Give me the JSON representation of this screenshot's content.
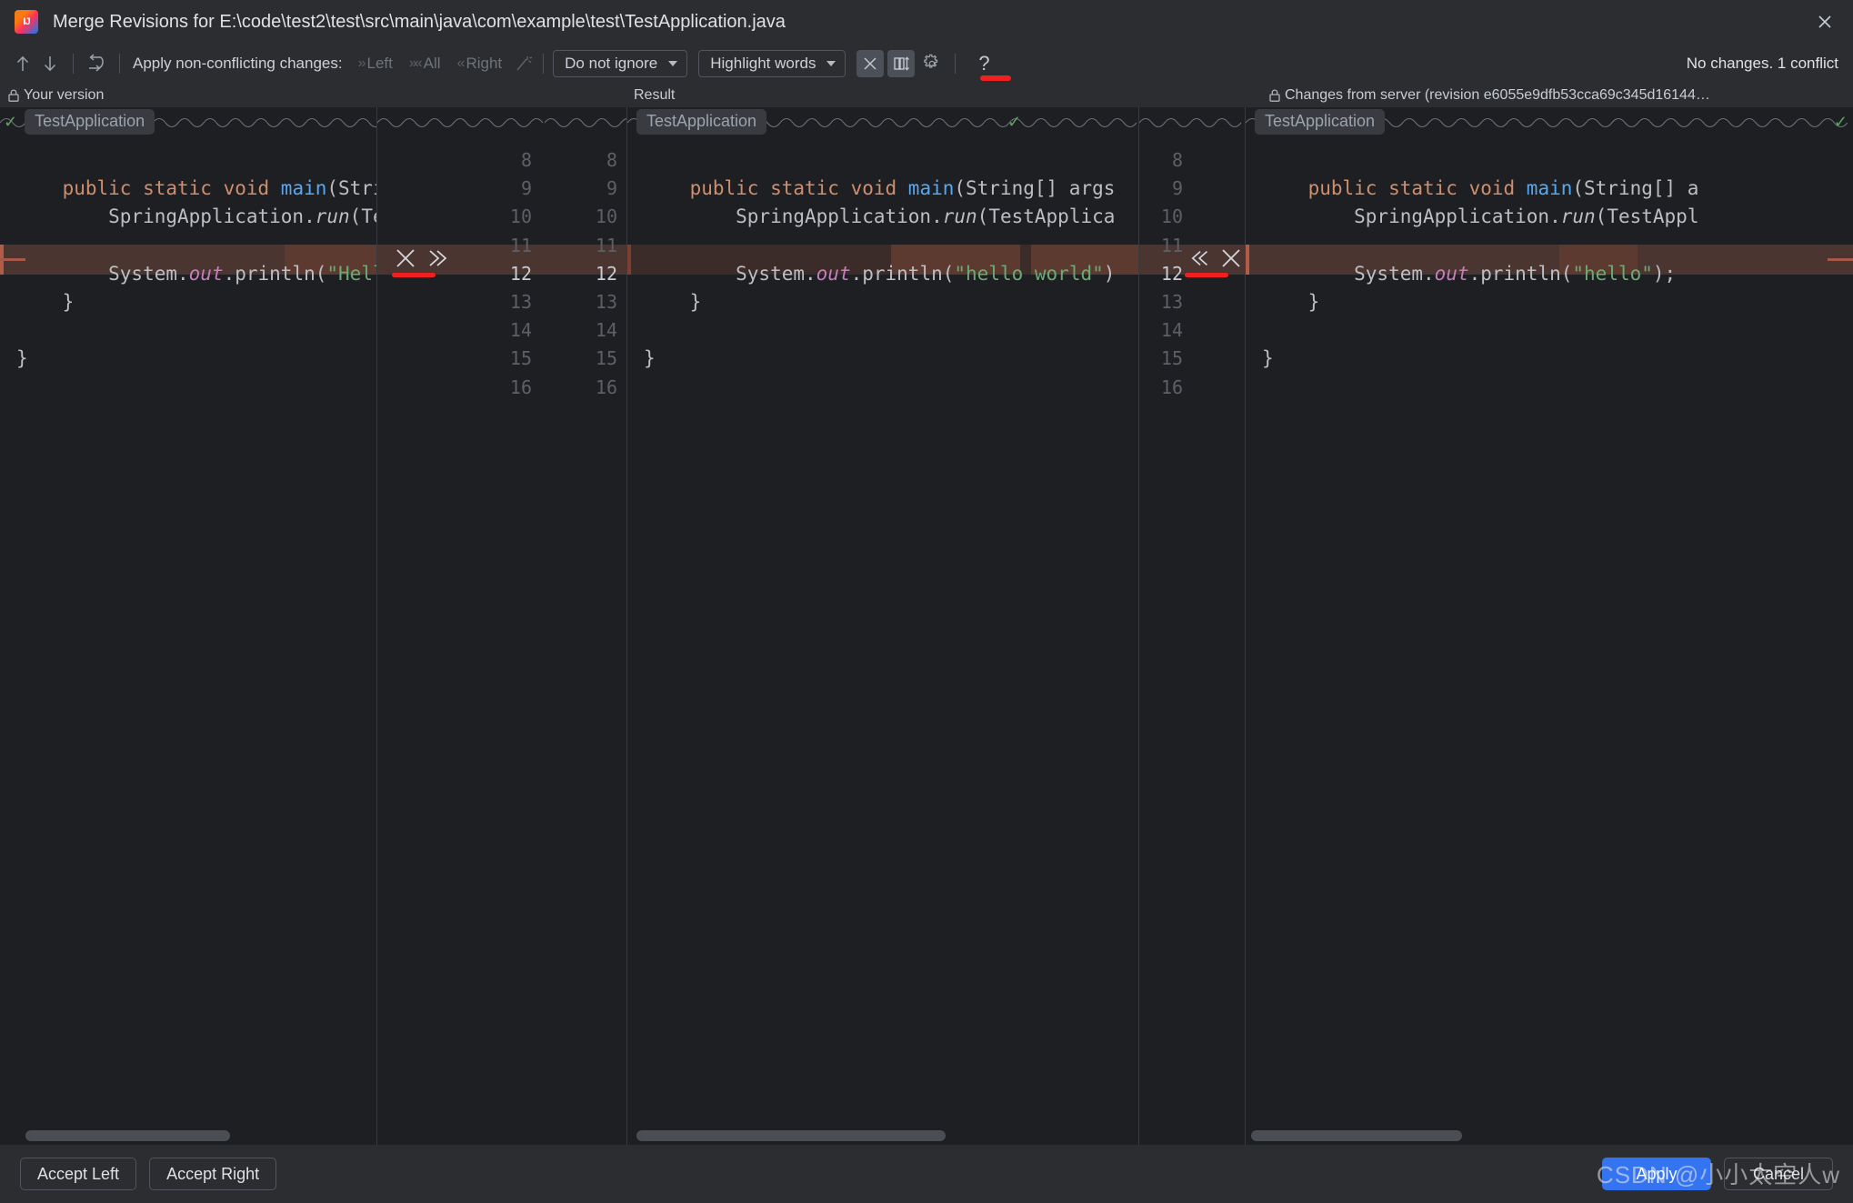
{
  "window": {
    "title": "Merge Revisions for E:\\code\\test2\\test\\src\\main\\java\\com\\example\\test\\TestApplication.java",
    "app_icon": "intellij-idea-icon",
    "close_icon": "close-icon"
  },
  "toolbar": {
    "prev_icon": "arrow-up-icon",
    "next_icon": "arrow-down-icon",
    "revert_icon": "revert-changes-icon",
    "apply_label": "Apply non-conflicting changes:",
    "apply_left": "Left",
    "apply_all": "All",
    "apply_right": "Right",
    "magic_icon": "magic-resolve-icon",
    "ignore_select": "Do not ignore",
    "highlight_select": "Highlight words",
    "collapse_icon": "collapse-unchanged-icon",
    "sync_scroll_icon": "synchronize-scrolling-icon",
    "settings_icon": "gear-icon",
    "help_icon": "help-icon",
    "status": "No changes. 1 conflict"
  },
  "panes": {
    "left_title": "Your version",
    "left_lock_icon": "lock-icon",
    "center_title": "Result",
    "right_title": "Changes from server (revision e6055e9dfb53cca69c345d16144…",
    "right_lock_icon": "lock-icon",
    "breadcrumb": "TestApplication",
    "breadcrumb_check_icon": "check-icon"
  },
  "code": {
    "left": {
      "lines": [
        {
          "tokens": [
            {
              "t": "",
              "c": "pln"
            }
          ]
        },
        {
          "tokens": [
            {
              "t": "    ",
              "c": "pln"
            },
            {
              "t": "public static void ",
              "c": "kw"
            },
            {
              "t": "main",
              "c": "meth"
            },
            {
              "t": "(String[] ",
              "c": "pln"
            }
          ]
        },
        {
          "tokens": [
            {
              "t": "        SpringApplication.",
              "c": "pln"
            },
            {
              "t": "run",
              "c": "ital"
            },
            {
              "t": "(TestApp",
              "c": "pln"
            }
          ]
        },
        {
          "tokens": [
            {
              "t": "",
              "c": "pln"
            }
          ]
        },
        {
          "tokens": [
            {
              "t": "        System.",
              "c": "pln"
            },
            {
              "t": "out",
              "c": "fld"
            },
            {
              "t": ".println(",
              "c": "pln"
            },
            {
              "t": "\"Hello Spr",
              "c": "str"
            }
          ]
        },
        {
          "tokens": [
            {
              "t": "    }",
              "c": "pln"
            }
          ]
        },
        {
          "tokens": [
            {
              "t": "",
              "c": "pln"
            }
          ]
        },
        {
          "tokens": [
            {
              "t": "}",
              "c": "pln"
            }
          ]
        }
      ]
    },
    "center": {
      "lines": [
        {
          "tokens": [
            {
              "t": "",
              "c": "pln"
            }
          ]
        },
        {
          "tokens": [
            {
              "t": "    ",
              "c": "pln"
            },
            {
              "t": "public static void ",
              "c": "kw"
            },
            {
              "t": "main",
              "c": "meth"
            },
            {
              "t": "(String[] args",
              "c": "pln"
            }
          ]
        },
        {
          "tokens": [
            {
              "t": "        SpringApplication.",
              "c": "pln"
            },
            {
              "t": "run",
              "c": "ital"
            },
            {
              "t": "(TestApplica",
              "c": "pln"
            }
          ]
        },
        {
          "tokens": [
            {
              "t": "",
              "c": "pln"
            }
          ]
        },
        {
          "tokens": [
            {
              "t": "        System.",
              "c": "pln"
            },
            {
              "t": "out",
              "c": "fld"
            },
            {
              "t": ".println(",
              "c": "pln"
            },
            {
              "t": "\"hello world\"",
              "c": "str"
            },
            {
              "t": ")",
              "c": "pln"
            }
          ]
        },
        {
          "tokens": [
            {
              "t": "    }",
              "c": "pln"
            }
          ]
        },
        {
          "tokens": [
            {
              "t": "",
              "c": "pln"
            }
          ]
        },
        {
          "tokens": [
            {
              "t": "}",
              "c": "pln"
            }
          ]
        }
      ]
    },
    "right": {
      "lines": [
        {
          "tokens": [
            {
              "t": "",
              "c": "pln"
            }
          ]
        },
        {
          "tokens": [
            {
              "t": "    ",
              "c": "pln"
            },
            {
              "t": "public static void ",
              "c": "kw"
            },
            {
              "t": "main",
              "c": "meth"
            },
            {
              "t": "(String[] a",
              "c": "pln"
            }
          ]
        },
        {
          "tokens": [
            {
              "t": "        SpringApplication.",
              "c": "pln"
            },
            {
              "t": "run",
              "c": "ital"
            },
            {
              "t": "(TestAppl",
              "c": "pln"
            }
          ]
        },
        {
          "tokens": [
            {
              "t": "",
              "c": "pln"
            }
          ]
        },
        {
          "tokens": [
            {
              "t": "        System.",
              "c": "pln"
            },
            {
              "t": "out",
              "c": "fld"
            },
            {
              "t": ".println(",
              "c": "pln"
            },
            {
              "t": "\"hello\"",
              "c": "str"
            },
            {
              "t": "); ",
              "c": "pln"
            }
          ]
        },
        {
          "tokens": [
            {
              "t": "    }",
              "c": "pln"
            }
          ]
        },
        {
          "tokens": [
            {
              "t": "",
              "c": "pln"
            }
          ]
        },
        {
          "tokens": [
            {
              "t": "}",
              "c": "pln"
            }
          ]
        }
      ]
    }
  },
  "line_numbers": {
    "left_gutter": [
      "8",
      "9",
      "10",
      "11",
      "12",
      "13",
      "14",
      "15",
      "16"
    ],
    "center_gutter": [
      "8",
      "9",
      "10",
      "11",
      "12",
      "13",
      "14",
      "15",
      "16"
    ],
    "right_gutter": [
      "8",
      "9",
      "10",
      "11",
      "12",
      "13",
      "14",
      "15",
      "16"
    ],
    "conflict_line": "12"
  },
  "merge_actions": {
    "left_accept_icon": "accept-conflict-x-icon",
    "left_apply_icon": "apply-right-chevrons-icon",
    "right_apply_icon": "apply-left-chevrons-icon",
    "right_accept_icon": "accept-conflict-x-icon"
  },
  "buttons": {
    "accept_left": "Accept Left",
    "accept_right": "Accept Right",
    "apply": "Apply",
    "cancel": "Cancel"
  },
  "watermark": "CSDN @小小太空人w",
  "colors": {
    "accent": "#3574f0",
    "conflict_bg": "#4a3531",
    "conflict_word_bg": "#5c3a30",
    "annotation_red": "#f02020",
    "string_green": "#6aab73",
    "keyword_orange": "#cf8e6d",
    "method_blue": "#56a8f5",
    "field_purple": "#c77dbb",
    "check_green": "#5aa75a",
    "bg_window": "#2b2d30",
    "bg_editor": "#1e1f22"
  }
}
